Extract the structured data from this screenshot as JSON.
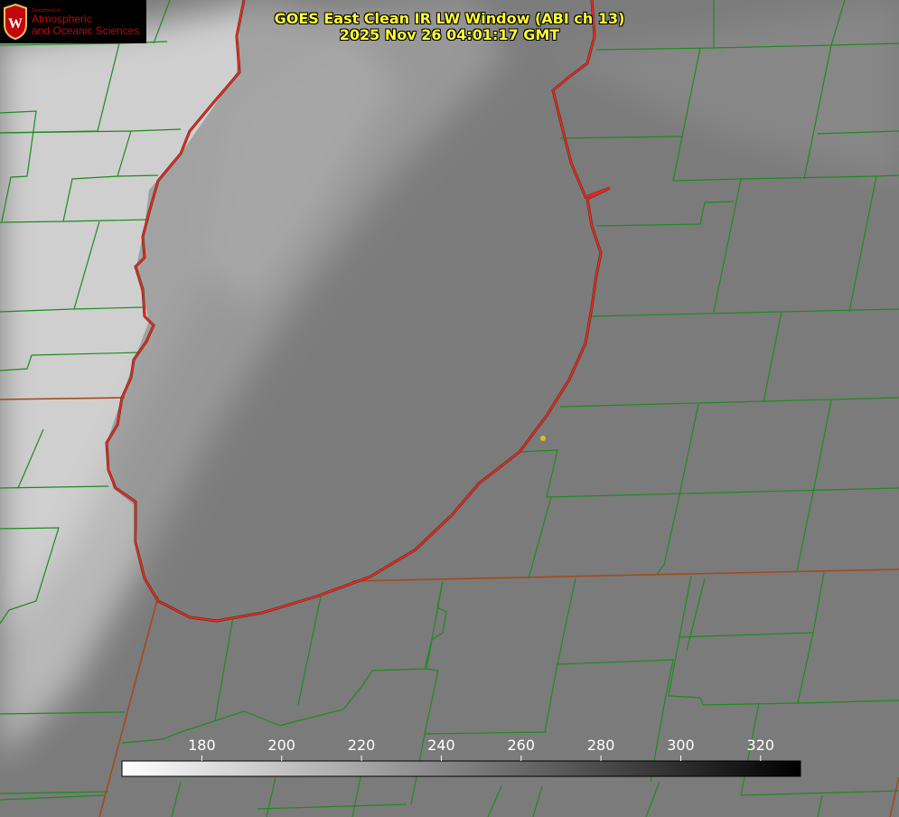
{
  "header": {
    "title": "GOES East Clean IR LW Window (ABI ch 13)",
    "timestamp": "2025 Nov 26 04:01:17 GMT"
  },
  "logo": {
    "line_small": "Department of",
    "line1": "Atmospheric",
    "line2": "and Oceanic Sciences",
    "seal_letter": "W"
  },
  "colorbar": {
    "min": 160,
    "max": 330,
    "ticks": [
      "180",
      "200",
      "220",
      "240",
      "260",
      "280",
      "300",
      "320"
    ],
    "tick_values": [
      180,
      200,
      220,
      240,
      260,
      280,
      300,
      320
    ]
  },
  "colors": {
    "county_lines": "#1e8a1e",
    "state_lines": "#a24a1a",
    "lake_outline": "#ff2020",
    "title_text": "#ffff33",
    "station_marker": "#d4c21a"
  }
}
